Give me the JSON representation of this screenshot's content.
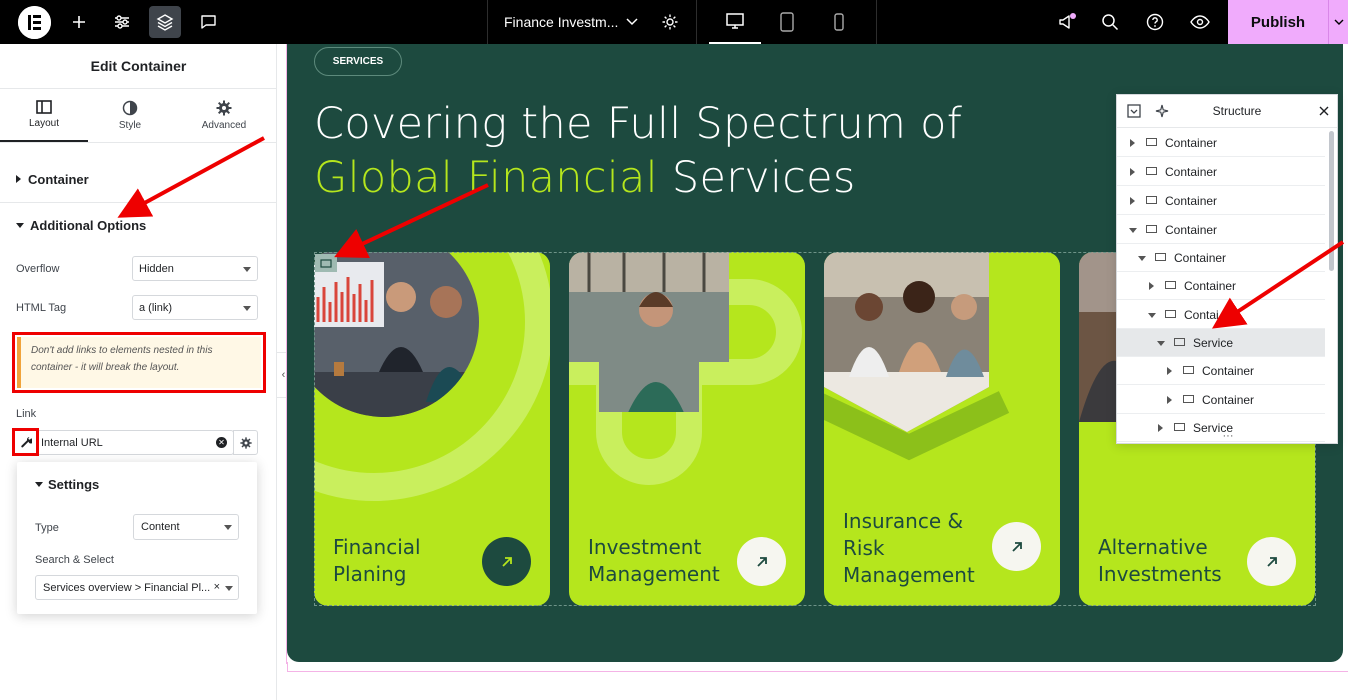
{
  "topbar": {
    "document_title": "Finance Investm...",
    "publish_label": "Publish"
  },
  "panel": {
    "title": "Edit Container",
    "tabs": [
      {
        "label": "Layout",
        "icon": "layout-icon"
      },
      {
        "label": "Style",
        "icon": "style-icon"
      },
      {
        "label": "Advanced",
        "icon": "gear-icon"
      }
    ],
    "section_container": "Container",
    "section_additional": "Additional Options",
    "overflow_label": "Overflow",
    "overflow_value": "Hidden",
    "html_tag_label": "HTML Tag",
    "html_tag_value": "a (link)",
    "warning": "Don't add links to elements nested in this container - it will break the layout.",
    "link_label": "Link",
    "link_value": "Internal URL",
    "settings": {
      "title": "Settings",
      "type_label": "Type",
      "type_value": "Content",
      "search_label": "Search & Select",
      "search_value": "Services overview > Financial Pl..."
    }
  },
  "canvas": {
    "pill": "SERVICES",
    "headline_line1": "Covering the Full Spectrum of",
    "headline_highlight": "Global Financial",
    "headline_rest": " Services",
    "cards": [
      {
        "title_line1": "Financial",
        "title_line2": "Planing",
        "title_line3": ""
      },
      {
        "title_line1": "Investment",
        "title_line2": "Management",
        "title_line3": ""
      },
      {
        "title_line1": "Insurance &",
        "title_line2": "Risk",
        "title_line3": "Management"
      },
      {
        "title_line1": "Alternative",
        "title_line2": "Investments",
        "title_line3": ""
      }
    ]
  },
  "structure": {
    "title": "Structure",
    "rows": [
      {
        "label": "Container",
        "expanded": false,
        "selected": false
      },
      {
        "label": "Container",
        "expanded": false,
        "selected": false
      },
      {
        "label": "Container",
        "expanded": false,
        "selected": false
      },
      {
        "label": "Container",
        "expanded": true,
        "selected": false
      },
      {
        "label": "Container",
        "expanded": true,
        "selected": false
      },
      {
        "label": "Container",
        "expanded": false,
        "selected": false
      },
      {
        "label": "Contai",
        "expanded": true,
        "selected": false
      },
      {
        "label": "Service",
        "expanded": true,
        "selected": true
      },
      {
        "label": "Container",
        "expanded": false,
        "selected": false
      },
      {
        "label": "Container",
        "expanded": false,
        "selected": false
      },
      {
        "label": "Service",
        "expanded": false,
        "selected": false
      }
    ]
  },
  "colors": {
    "canvas_bg": "#1d4a3f",
    "accent_lime": "#b5e61d",
    "publish_bg": "#f0abfc",
    "annotation_red": "#e00000"
  }
}
